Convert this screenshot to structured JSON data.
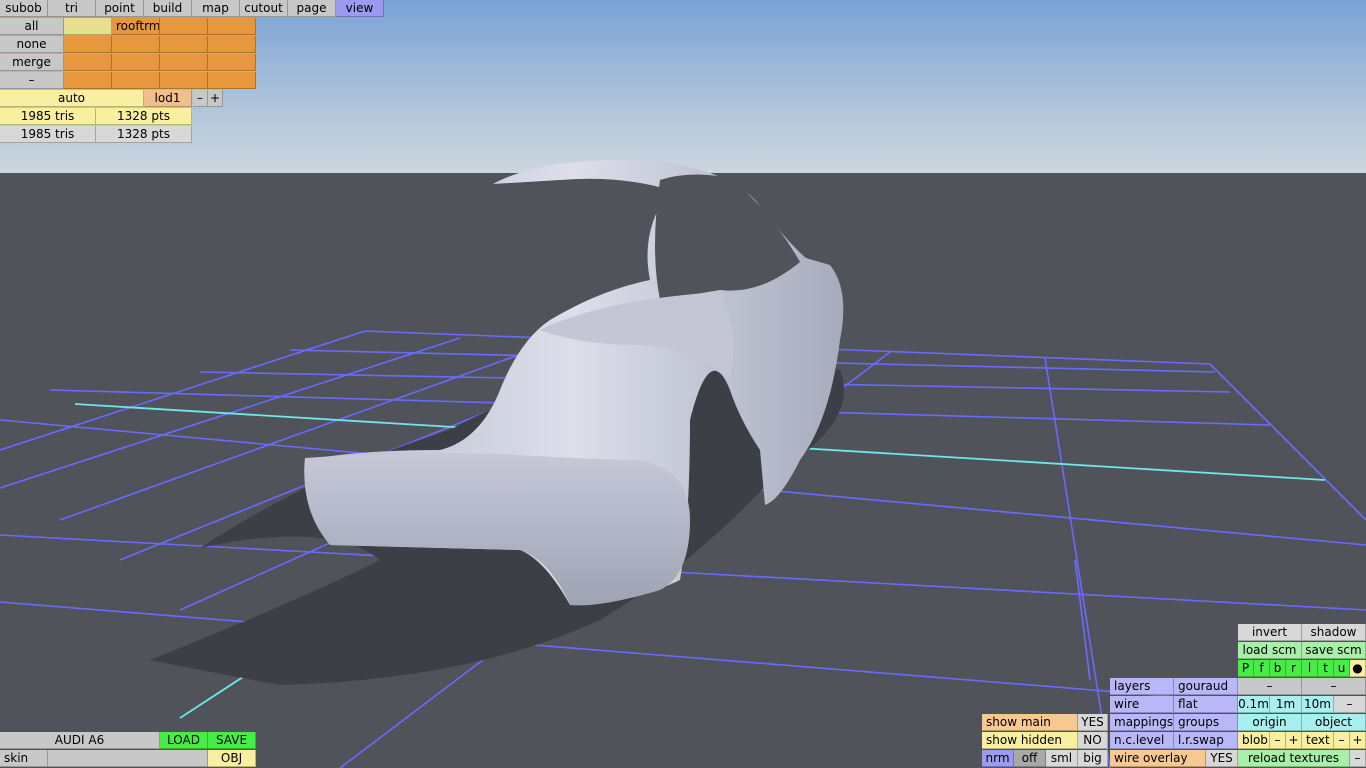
{
  "menu": {
    "items": [
      "subob",
      "tri",
      "point",
      "build",
      "map",
      "cutout",
      "page",
      "view"
    ],
    "active": "view"
  },
  "layers_panel": {
    "selectors": [
      "all",
      "none",
      "merge",
      "–"
    ],
    "first_layer_name": "rooftrm"
  },
  "lod": {
    "mode": "auto",
    "level": "lod1",
    "minus": "–",
    "plus": "+"
  },
  "stats": [
    {
      "tris": "1985 tris",
      "pts": "1328 pts"
    },
    {
      "tris": "1985 tris",
      "pts": "1328 pts"
    }
  ],
  "file": {
    "name": "AUDI A6",
    "load": "LOAD",
    "save": "SAVE",
    "skin": "skin",
    "format": "OBJ"
  },
  "show": {
    "main_label": "show main",
    "main_value": "YES",
    "hidden_label": "show hidden",
    "hidden_value": "NO"
  },
  "size_modes": [
    "nrm",
    "off",
    "sml",
    "big"
  ],
  "render": {
    "layers": "layers",
    "gouraud": "gouraud",
    "wire": "wire",
    "flat": "flat",
    "mappings": "mappings",
    "groups": "groups",
    "nclevel": "n.c.level",
    "lrswap": "l.r.swap",
    "wire_overlay": "wire overlay",
    "wire_overlay_value": "YES"
  },
  "scene": {
    "invert": "invert",
    "shadow": "shadow",
    "load_scm": "load scm",
    "save_scm": "save scm",
    "views": [
      "P",
      "f",
      "b",
      "r",
      "l",
      "t",
      "u",
      "●"
    ],
    "dash1": "–",
    "dash2": "–",
    "grid": [
      "0.1m",
      "1m",
      "10m",
      "–"
    ],
    "origin": "origin",
    "object": "object",
    "blob": "blob",
    "blob_minus": "–",
    "blob_plus": "+",
    "text": "text",
    "text_minus": "–",
    "text_plus": "+",
    "reload": "reload textures",
    "reload_minus": "–"
  },
  "colors": {
    "sky_top": "#7aa4d6",
    "sky_bottom": "#c9d6e0",
    "ground": "#50535a",
    "grid_line": "#6a6aff",
    "axis_line": "#6ee8e8",
    "car_body": "#d8dae8"
  }
}
